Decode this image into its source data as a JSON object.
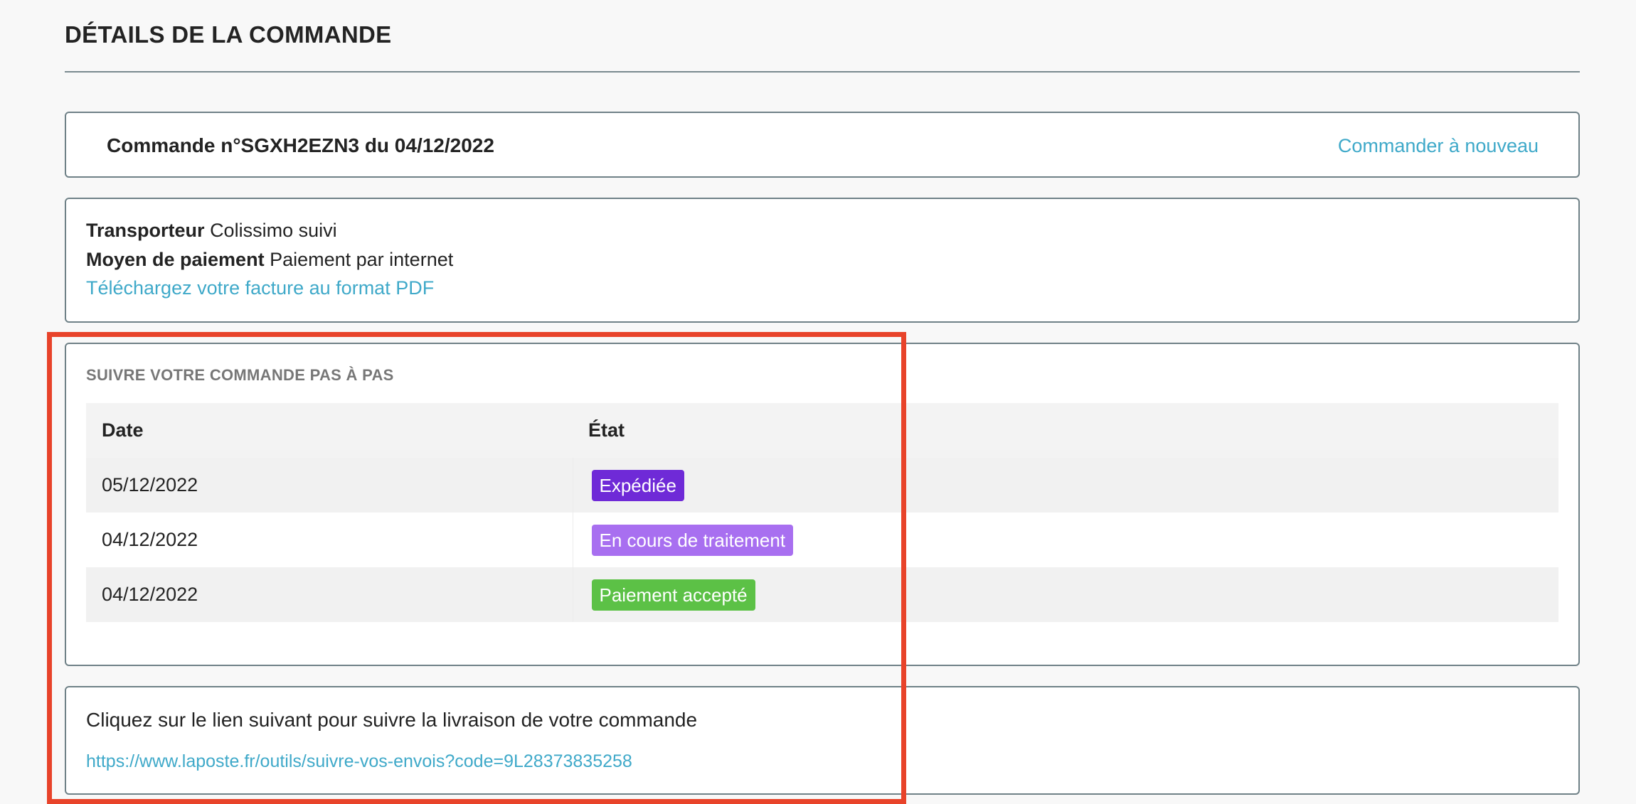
{
  "page": {
    "title": "DÉTAILS DE LA COMMANDE"
  },
  "order_header": {
    "title": "Commande n°SGXH2EZN3 du 04/12/2022",
    "reorder_label": "Commander à nouveau"
  },
  "order_info": {
    "carrier_label": "Transporteur",
    "carrier_value": "Colissimo suivi",
    "payment_label": "Moyen de paiement",
    "payment_value": "Paiement par internet",
    "invoice_link": "Téléchargez votre facture au format PDF"
  },
  "history": {
    "title": "SUIVRE VOTRE COMMANDE PAS À PAS",
    "columns": [
      "Date",
      "État"
    ],
    "rows": [
      {
        "date": "05/12/2022",
        "status": "Expédiée",
        "color": "#6f2ad7"
      },
      {
        "date": "04/12/2022",
        "status": "En cours de traitement",
        "color": "#a86ff0"
      },
      {
        "date": "04/12/2022",
        "status": "Paiement accepté",
        "color": "#5cc146"
      }
    ]
  },
  "tracking": {
    "text": "Cliquez sur le lien suivant pour suivre la livraison de votre commande",
    "url": "https://www.laposte.fr/outils/suivre-vos-envois?code=9L28373835258"
  },
  "colors": {
    "link": "#3fa9c9",
    "border": "#6f8187",
    "highlight": "#e8432a"
  }
}
